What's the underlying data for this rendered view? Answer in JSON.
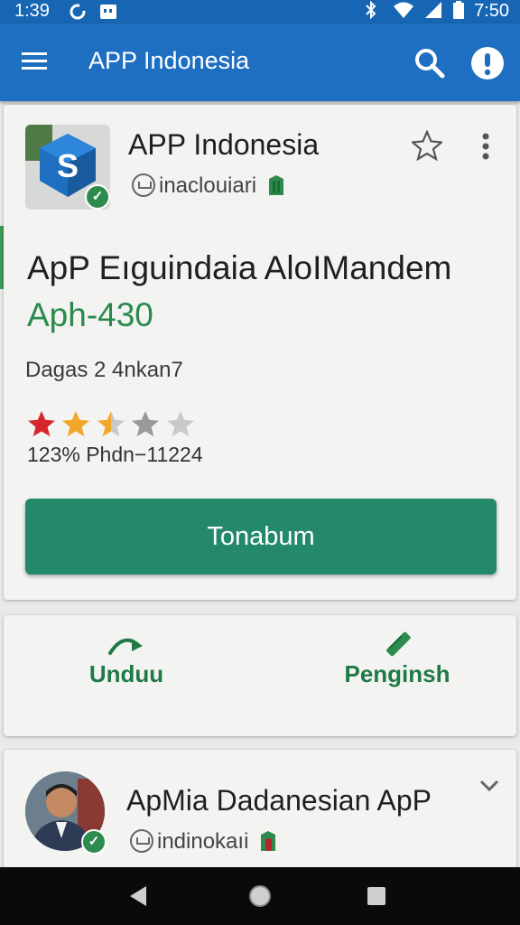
{
  "status_bar": {
    "time": "1:39",
    "clock": "7:50"
  },
  "app_bar": {
    "title": "APP Indonesia",
    "icons": [
      "menu-icon",
      "search-icon",
      "alert-icon"
    ]
  },
  "app_card": {
    "app_name": "APP Indonesia",
    "developer": "inaclouiari",
    "headline": "ApP Eıguindaia AloIMandem",
    "version": "Aph-430",
    "meta": "Dagas 2 4nkan7",
    "rating": 2.5,
    "rating_text": "123%  Phdn−11224",
    "primary_button": "Tonabum",
    "accent_color": "#2a8a4d",
    "button_color": "#23896a"
  },
  "actions": [
    {
      "label": "Unduu",
      "icon": "redo-arrow-icon"
    },
    {
      "label": "Penginsh",
      "icon": "pencil-icon"
    }
  ],
  "second_card": {
    "app_name": "ApMia Dadanesian ApP",
    "developer": "indinokaıi"
  }
}
